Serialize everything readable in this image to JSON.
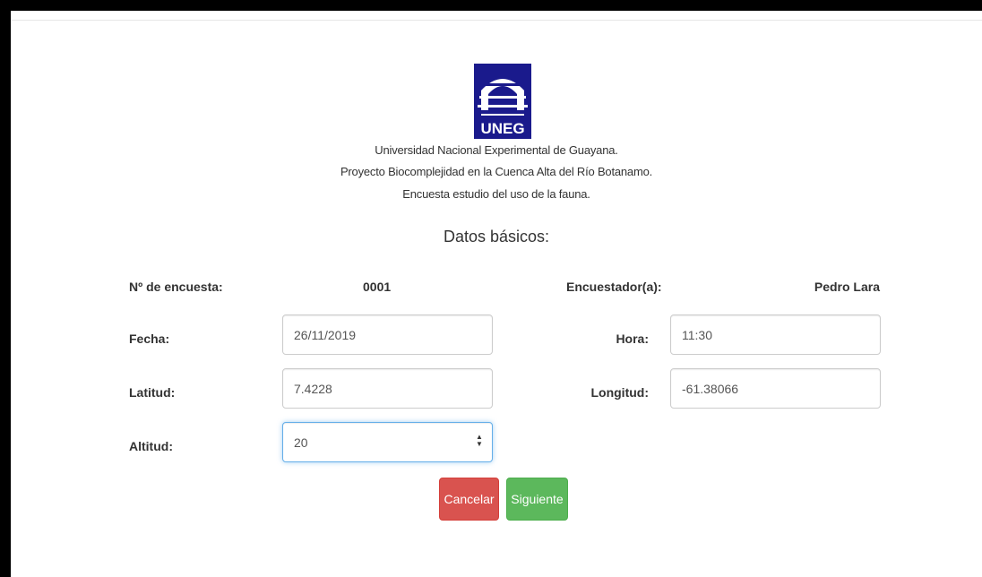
{
  "header": {
    "logo_text": "UNEG",
    "line1": "Universidad Nacional Experimental de Guayana.",
    "line2": "Proyecto Biocomplejidad en la Cuenca Alta del Río Botanamo.",
    "line3": "Encuesta estudio del uso de la fauna."
  },
  "section_title": "Datos básicos:",
  "form": {
    "encuesta_label": "Nº de encuesta:",
    "encuesta_value": "0001",
    "encuestador_label": "Encuestador(a):",
    "encuestador_value": "Pedro Lara",
    "fecha_label": "Fecha:",
    "fecha_value": "26/11/2019",
    "hora_label": "Hora:",
    "hora_value": "11:30",
    "latitud_label": "Latitud:",
    "latitud_value": "7.4228",
    "longitud_label": "Longitud:",
    "longitud_value": "-61.38066",
    "altitud_label": "Altitud:",
    "altitud_value": "20"
  },
  "buttons": {
    "cancel_label": "Cancelar",
    "next_label": "Siguiente"
  },
  "colors": {
    "logo_blue": "#1a1a8c",
    "cancel": "#d9534f",
    "next": "#5cb85c",
    "focus": "#66afe9"
  }
}
